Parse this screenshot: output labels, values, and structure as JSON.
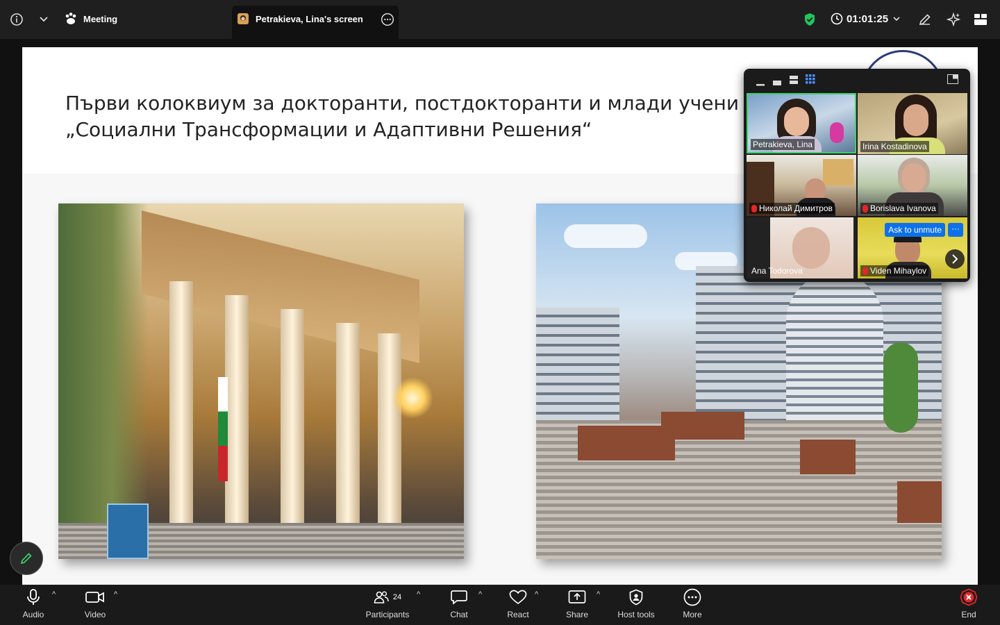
{
  "topbar": {
    "meeting_label": "Meeting",
    "screen_tab_label": "Petrakieva, Lina's screen",
    "timer": "01:01:25"
  },
  "slide": {
    "title_line1": "Първи колоквиум за докторанти, постдокторанти и млади учени",
    "title_line2": "„Социални Трансформации и Адаптивни Решения“"
  },
  "gallery": {
    "participants": [
      {
        "name": "Petrakieva, Lina",
        "muted": false,
        "active": true
      },
      {
        "name": "Irina Kostadinova",
        "muted": false
      },
      {
        "name": "Николай Димитров",
        "muted": true
      },
      {
        "name": "Borislava Ivanova",
        "muted": true
      },
      {
        "name": "Ana Todorova",
        "muted": false
      },
      {
        "name": "Viden Mihaylov",
        "muted": true
      }
    ],
    "ask_to_unmute": "Ask to unmute",
    "more_dots": "···"
  },
  "toolbar": {
    "audio": "Audio",
    "video": "Video",
    "participants": "Participants",
    "participants_count": "24",
    "chat": "Chat",
    "react": "React",
    "share": "Share",
    "host_tools": "Host tools",
    "more": "More",
    "end": "End"
  },
  "colors": {
    "accent_blue": "#0e71eb",
    "security_green": "#21c55d",
    "end_red": "#e02828",
    "speaker_border": "#3dd168"
  }
}
